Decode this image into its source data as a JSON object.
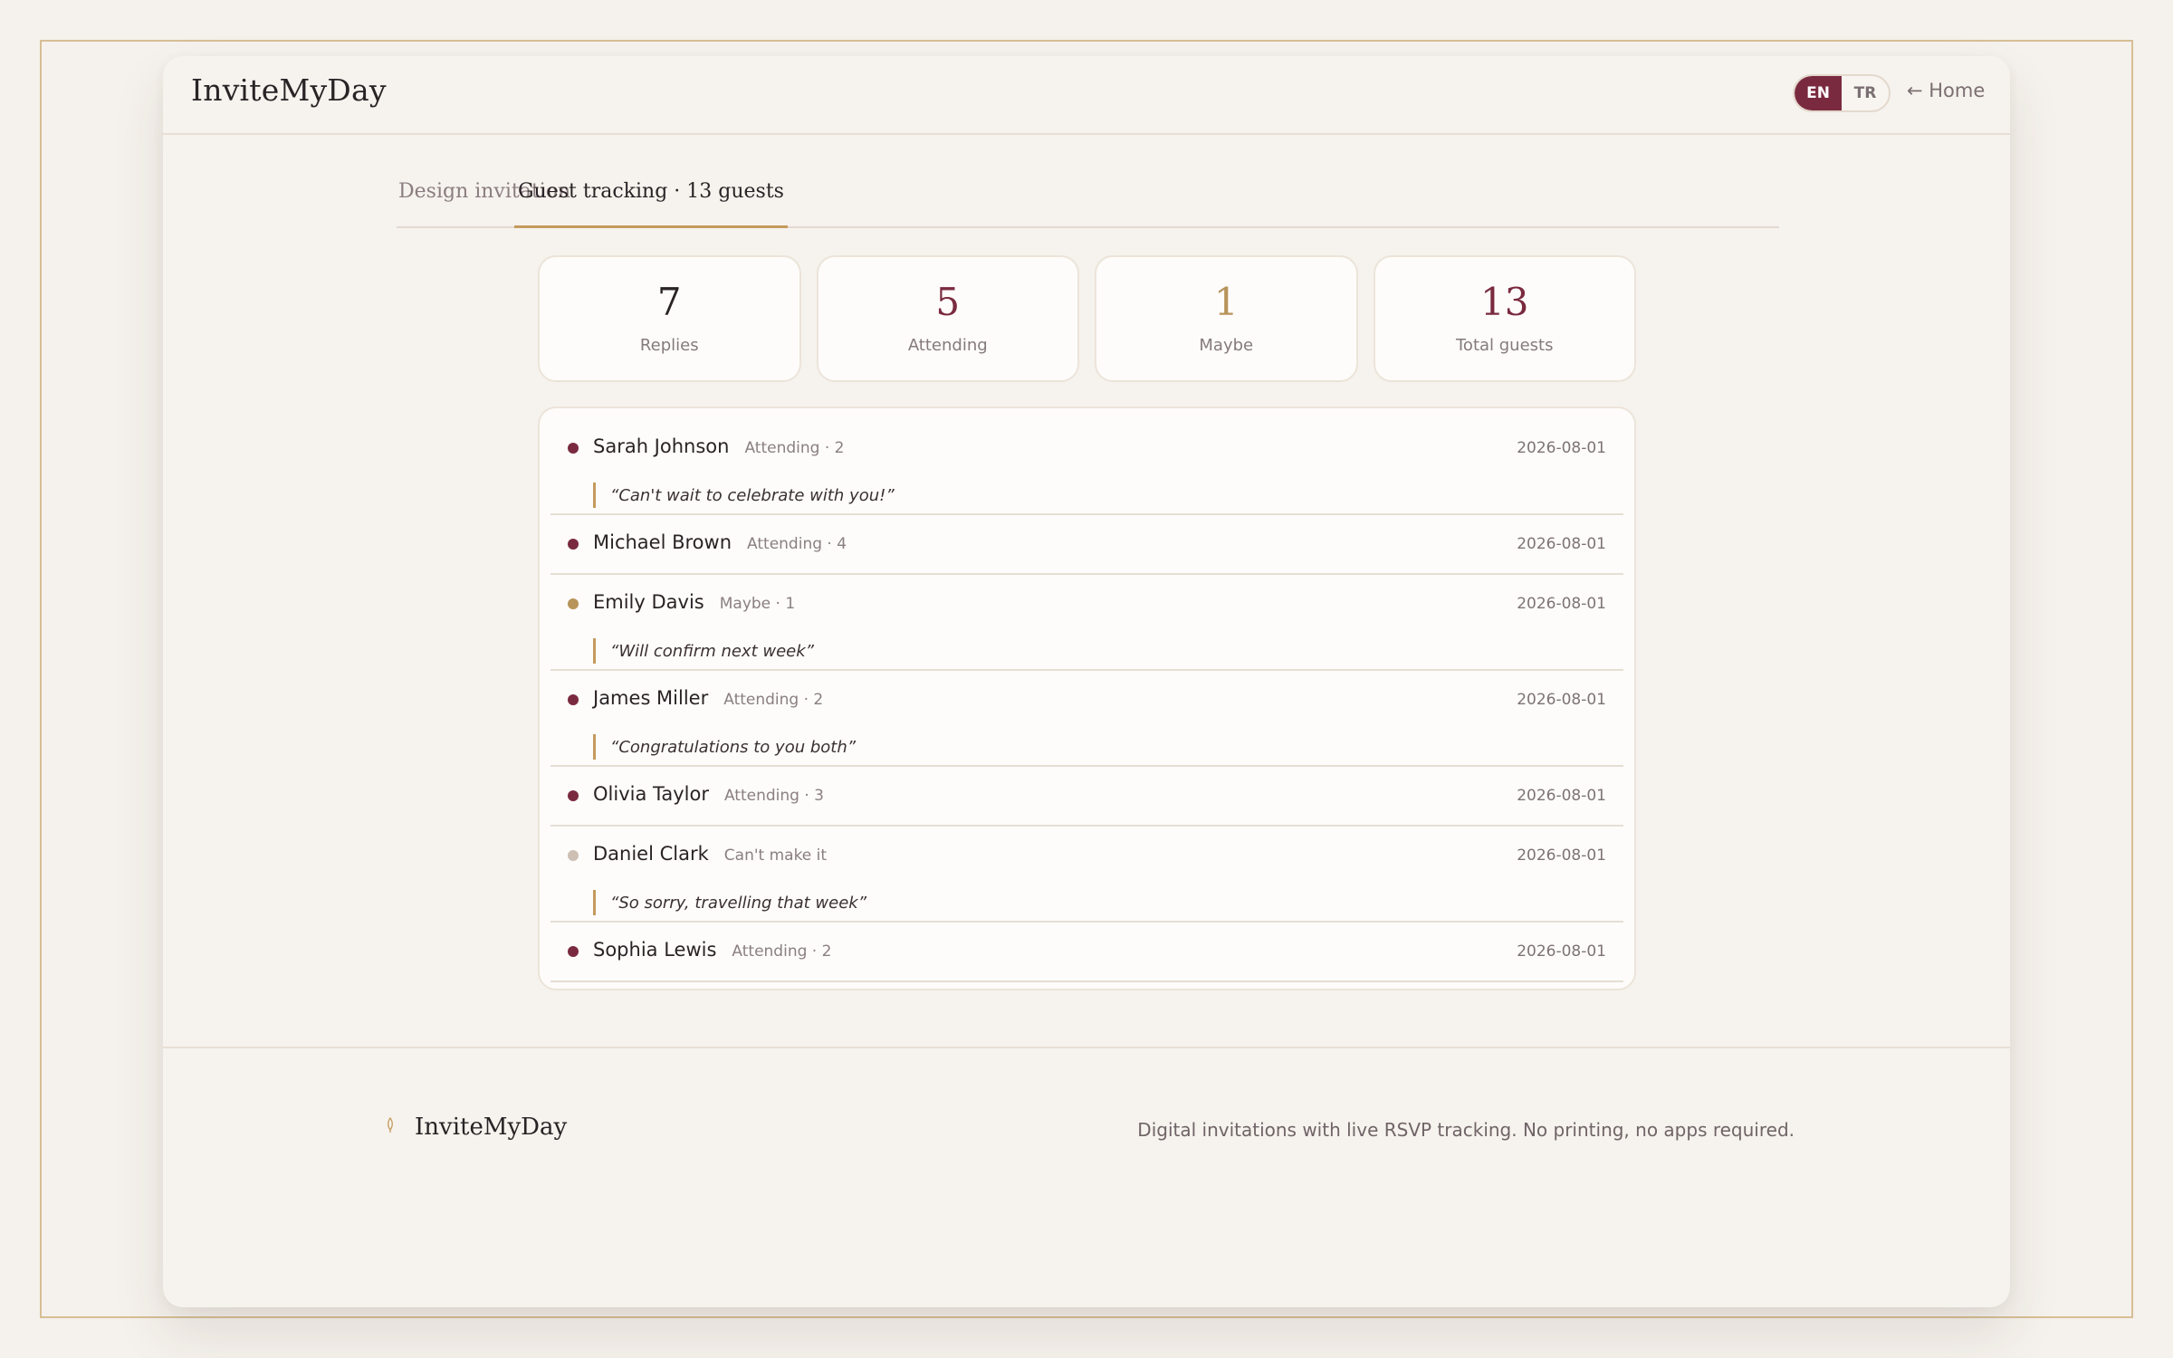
{
  "app": {
    "brand": "InviteMyDay"
  },
  "header": {
    "languages": [
      {
        "code": "EN",
        "active": true
      },
      {
        "code": "TR",
        "active": false
      }
    ],
    "home_link": "← Home"
  },
  "tabs": [
    {
      "label": "Design invitation",
      "active": false
    },
    {
      "label": "Guest tracking · 13 guests",
      "active": true
    }
  ],
  "stats": [
    {
      "value": "7",
      "label": "Replies",
      "color": "#2a2326"
    },
    {
      "value": "5",
      "label": "Attending",
      "color": "#7a2a3f"
    },
    {
      "value": "1",
      "label": "Maybe",
      "color": "#b8935a"
    },
    {
      "value": "13",
      "label": "Total guests",
      "color": "#7a2a3f"
    }
  ],
  "rsvps": [
    {
      "name": "Sarah Johnson",
      "status": "Attending · 2",
      "date": "2026-08-01",
      "note": "“Can't wait to celebrate with you!”",
      "dot_color": "#7a2a3f"
    },
    {
      "name": "Michael Brown",
      "status": "Attending · 4",
      "date": "2026-08-01",
      "note": "",
      "dot_color": "#7a2a3f"
    },
    {
      "name": "Emily Davis",
      "status": "Maybe · 1",
      "date": "2026-08-01",
      "note": "“Will confirm next week”",
      "dot_color": "#b8935a"
    },
    {
      "name": "James Miller",
      "status": "Attending · 2",
      "date": "2026-08-01",
      "note": "“Congratulations to you both”",
      "dot_color": "#7a2a3f"
    },
    {
      "name": "Olivia Taylor",
      "status": "Attending · 3",
      "date": "2026-08-01",
      "note": "",
      "dot_color": "#7a2a3f"
    },
    {
      "name": "Daniel Clark",
      "status": "Can't make it",
      "date": "2026-08-01",
      "note": "“So sorry, travelling that week”",
      "dot_color": "#cdbfb3"
    },
    {
      "name": "Sophia Lewis",
      "status": "Attending · 2",
      "date": "2026-08-01",
      "note": "",
      "dot_color": "#7a2a3f"
    }
  ],
  "footer": {
    "brand": "InviteMyDay",
    "brand_icon": "quill-icon",
    "tagline": "Digital invitations with live RSVP tracking. No printing, no apps required."
  }
}
